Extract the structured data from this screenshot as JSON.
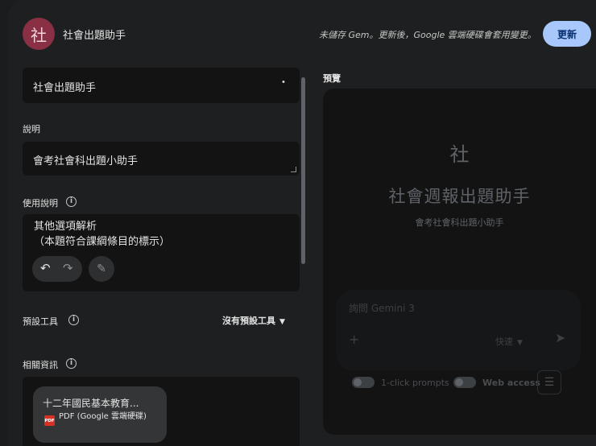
{
  "header": {
    "avatar_letter": "社",
    "title": "社會出題助手",
    "notice": "未儲存 Gem。更新後，Google 雲端硬碟會套用變更。",
    "update_button": "更新"
  },
  "form": {
    "name_value": "社會出題助手",
    "description_label": "說明",
    "description_value": "會考社會科出題小助手",
    "instructions_label": "使用說明",
    "instructions_lines": [
      "其他選項解析",
      "（本題符合課綱條目的標示）"
    ],
    "default_tools_label": "預設工具",
    "default_tools_value": "沒有預設工具",
    "knowledge_label": "相關資訊",
    "file": {
      "name": "十二年國民基本教育...",
      "type": "PDF (Google 雲端硬碟)",
      "badge": "PDF"
    }
  },
  "preview": {
    "label": "預覽",
    "avatar_letter": "社",
    "title": "社會週報出題助手",
    "description": "會考社會科出題小助手",
    "input_placeholder": "詢問 Gemini 3",
    "model": "快速",
    "toggle1_label": "1-click prompts",
    "toggle2_label": "Web access"
  },
  "icons": {
    "info": "info-icon",
    "undo": "undo-icon",
    "redo": "redo-icon",
    "magic": "magic-wand-icon",
    "chevron": "chevron-down-icon",
    "plus": "plus-icon",
    "send": "send-icon",
    "tune": "tune-icon"
  },
  "colors": {
    "accent": "#a8c7fa",
    "avatar": "#8a3045"
  }
}
